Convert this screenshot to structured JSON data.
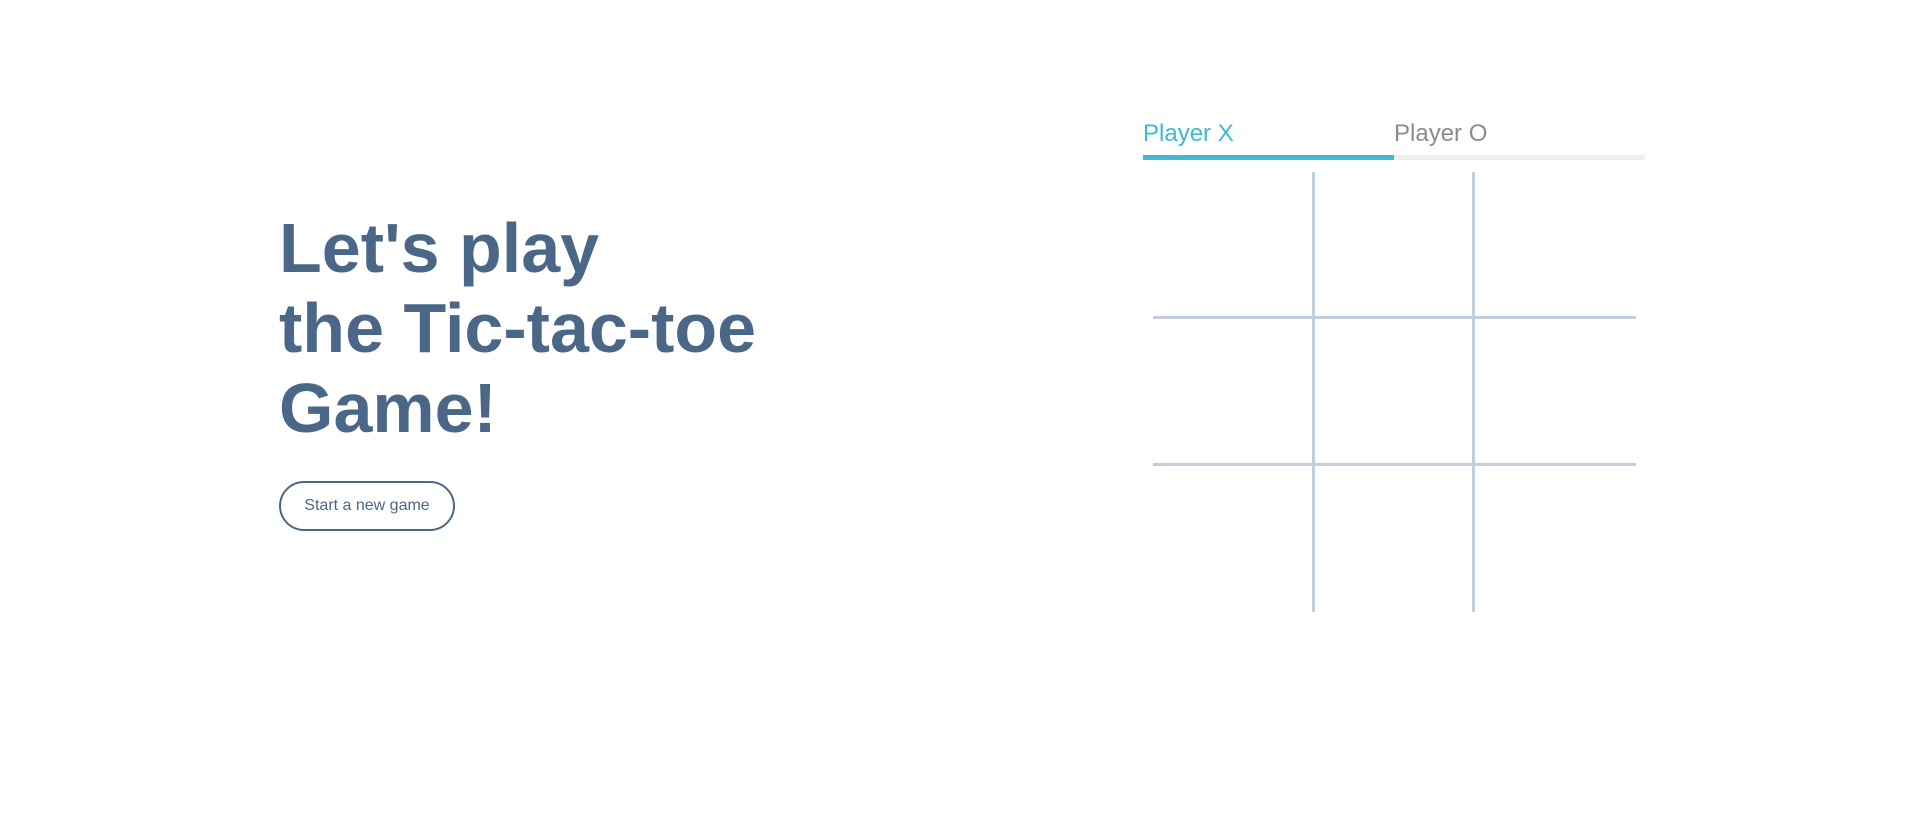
{
  "intro": {
    "headline_lines": [
      "Let's play",
      "the Tic-tac-toe",
      "Game!"
    ],
    "new_game_label": "Start a new game"
  },
  "players": [
    {
      "label": "Player X",
      "active": true
    },
    {
      "label": "Player O",
      "active": false
    }
  ],
  "board": {
    "cells": [
      "",
      "",
      "",
      "",
      "",
      "",
      "",
      "",
      ""
    ]
  },
  "colors": {
    "primary": "#4a6788",
    "accent": "#3fb9d0",
    "inactive_text": "#8c8c8c",
    "inactive_bar": "#eeeeee",
    "grid": "#c2cedb"
  }
}
